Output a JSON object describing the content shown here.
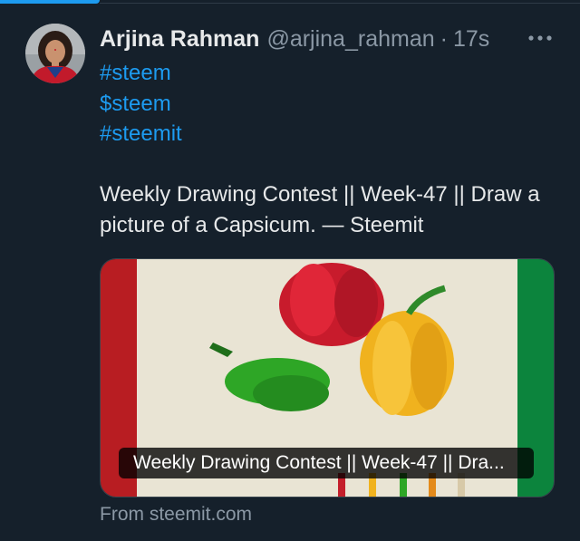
{
  "tweet": {
    "display_name": "Arjina Rahman",
    "handle": "@arjina_rahman",
    "separator": "·",
    "timestamp": "17s",
    "hashtags": [
      "#steem",
      "$steem",
      "#steemit"
    ],
    "text": "Weekly Drawing Contest || Week-47 || Draw a picture of a Capsicum. — Steemit",
    "card": {
      "title": "Weekly Drawing Contest || Week-47 || Dra...",
      "source": "From steemit.com"
    }
  },
  "icons": {
    "more": "more-horizontal-icon"
  },
  "colors": {
    "background": "#15202b",
    "link": "#1d9bf0",
    "primary_text": "#e7e9ea",
    "secondary_text": "#8b98a5"
  }
}
